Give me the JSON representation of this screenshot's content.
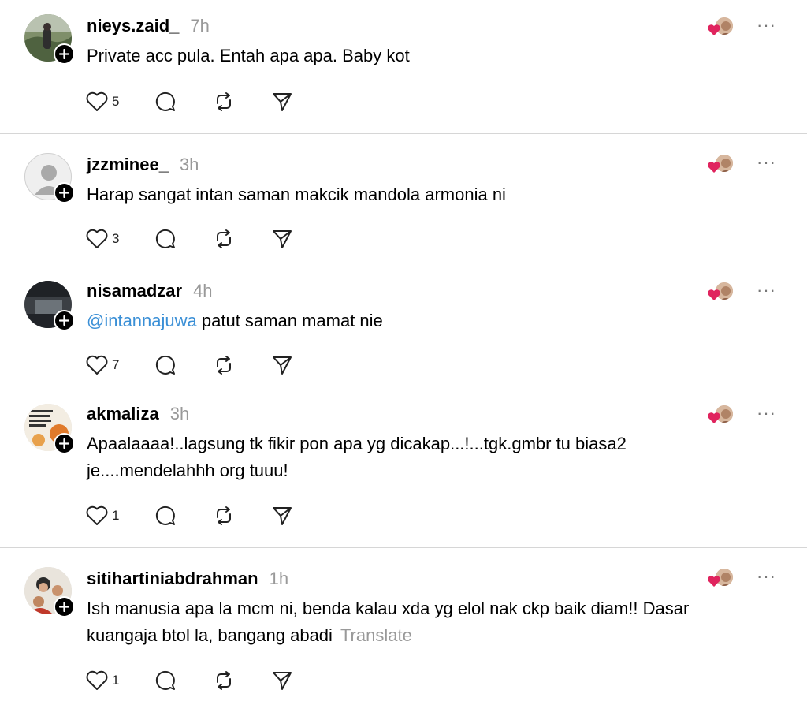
{
  "comments": [
    {
      "username": "nieys.zaid_",
      "time": "7h",
      "text_lines": [
        "Private acc pula. Entah apa apa. Baby kot"
      ],
      "likes": "5",
      "avatar": "landscape-person",
      "follow_icon": "plus-icon"
    },
    {
      "username": "jzzminee_",
      "time": "3h",
      "text_lines": [
        "Harap sangat intan saman makcik mandola armonia ni"
      ],
      "likes": "3",
      "avatar": "default-person",
      "follow_icon": "plus-icon"
    },
    {
      "username": "nisamadzar",
      "time": "4h",
      "mention": "@intannajuwa",
      "text_after_mention": " patut saman mamat nie",
      "likes": "7",
      "avatar": "dark-photo",
      "follow_icon": "plus-icon"
    },
    {
      "username": "akmaliza",
      "time": "3h",
      "text_lines": [
        "Apaalaaaa!..lagsung tk fikir pon apa yg dicakap...!...tgk.gmbr tu biasa2",
        "je....mendelahhh org tuuu!"
      ],
      "likes": "1",
      "avatar": "quote-poster",
      "follow_icon": "plus-icon"
    },
    {
      "username": "sitihartiniabdrahman",
      "time": "1h",
      "text_lines": [
        "Ish manusia apa la mcm ni, benda kalau xda yg elol nak ckp baik diam!! Dasar",
        "kuangaja btol la, bangang abadi"
      ],
      "translate": "Translate",
      "likes": "1",
      "avatar": "family-photo",
      "follow_icon": "plus-icon"
    }
  ],
  "icons": {
    "like": "heart-outline-icon",
    "reply": "comment-bubble-icon",
    "repost": "repost-icon",
    "share": "send-icon",
    "more": "more-horizontal-icon",
    "liked_by": "liked-by-author-icon"
  },
  "more_label": "···",
  "colors": {
    "mention": "#3a8fd6",
    "heart": "#e0245e",
    "muted": "#999999"
  }
}
